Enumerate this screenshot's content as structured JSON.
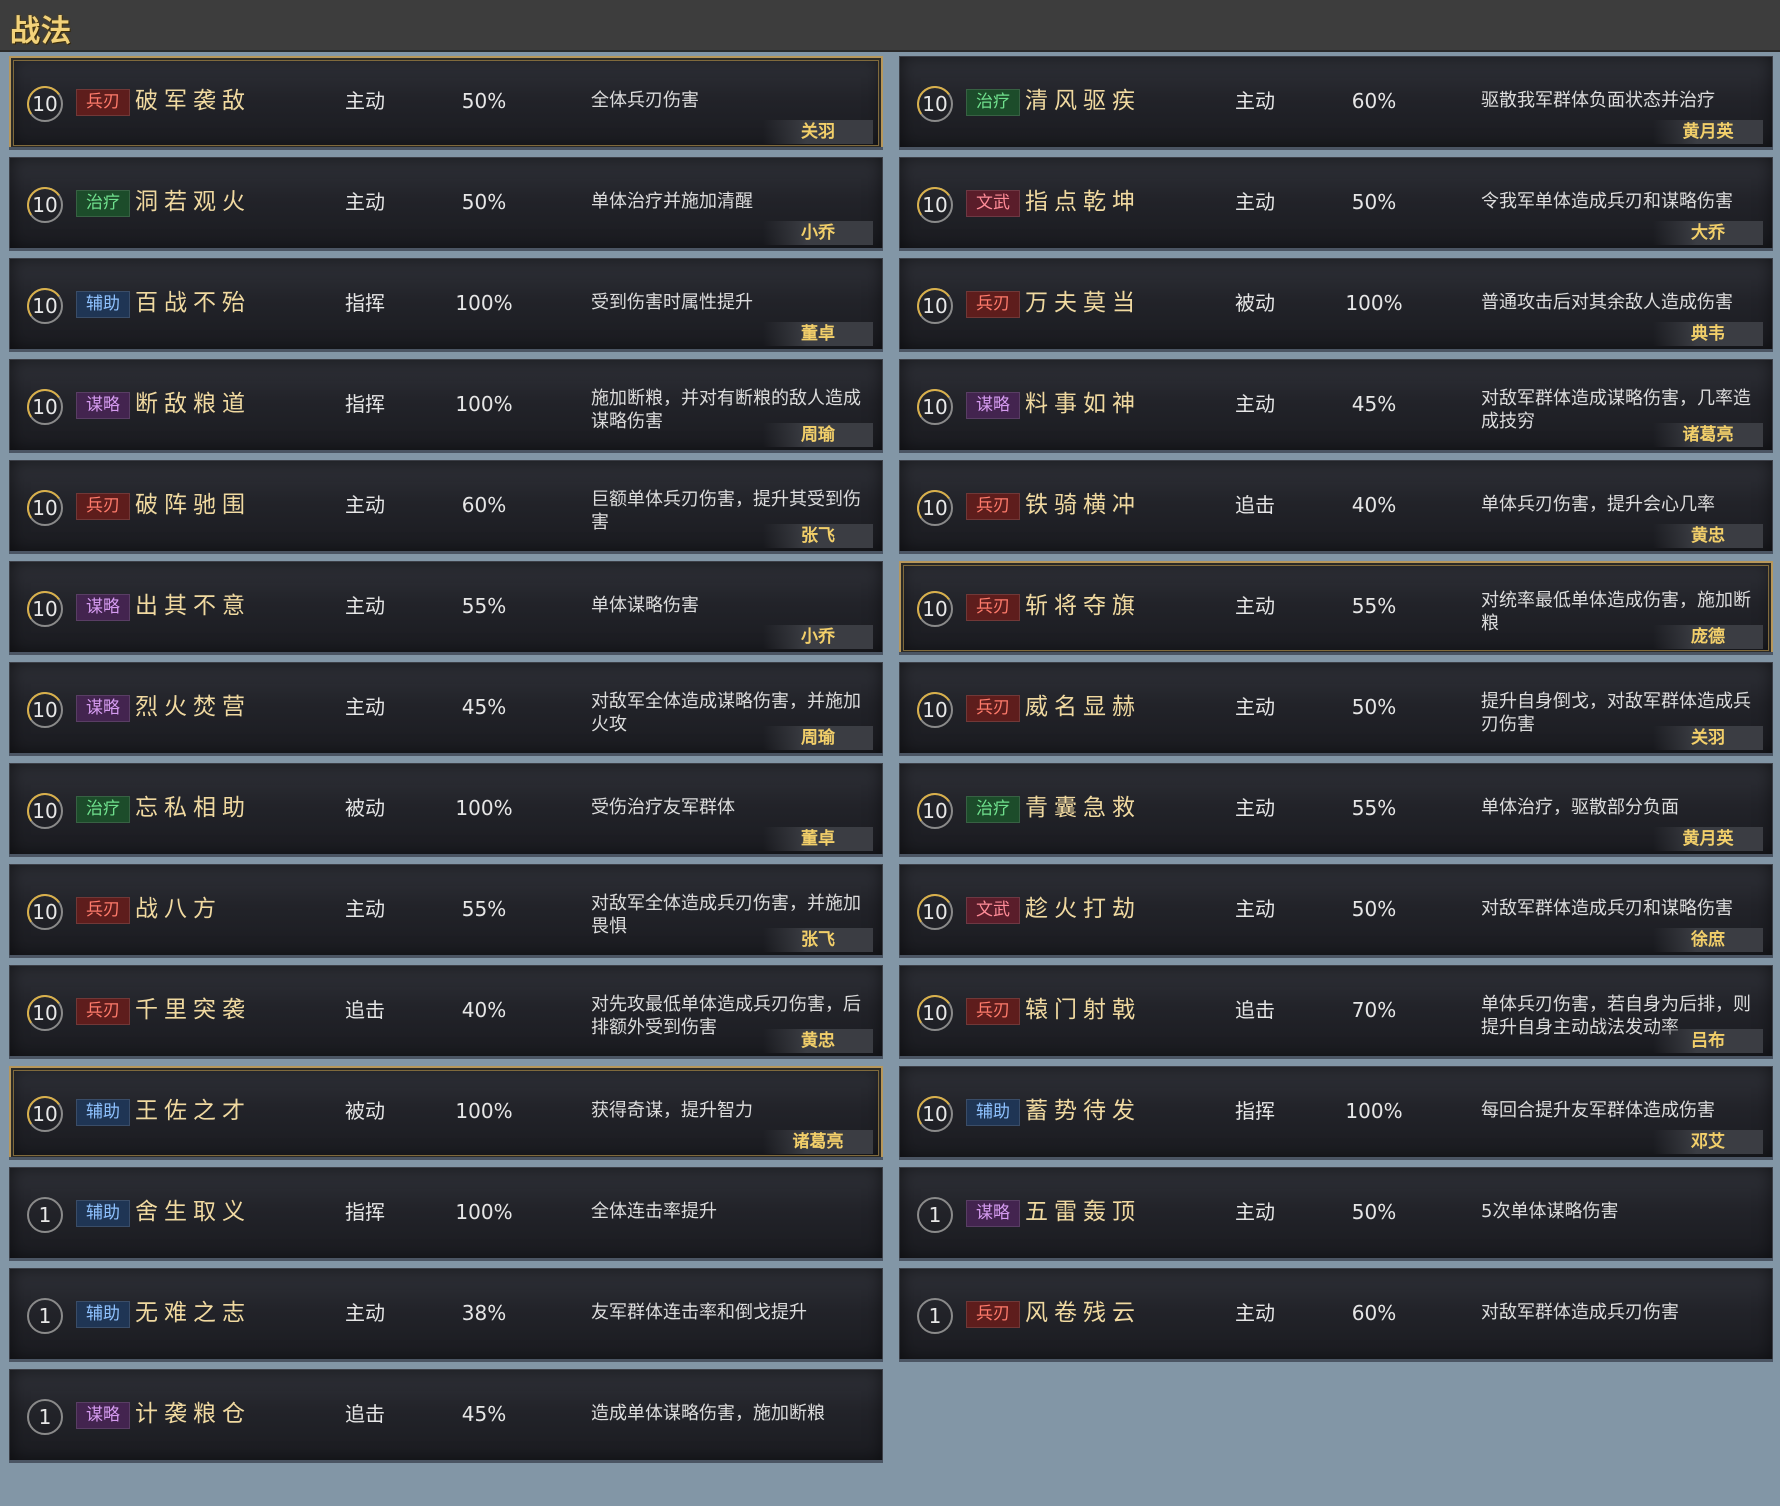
{
  "header": {
    "title": "战法"
  },
  "left": [
    {
      "level": "10",
      "tag": "兵刃",
      "tagClass": "t-bing",
      "name": "破军袭敌",
      "type": "主动",
      "rate": "50%",
      "desc": "全体兵刃伤害",
      "hero": "关羽",
      "gold": true
    },
    {
      "level": "10",
      "tag": "治疗",
      "tagClass": "t-zhi",
      "name": "洞若观火",
      "type": "主动",
      "rate": "50%",
      "desc": "单体治疗并施加清醒",
      "hero": "小乔",
      "gold": false
    },
    {
      "level": "10",
      "tag": "辅助",
      "tagClass": "t-fu",
      "name": "百战不殆",
      "type": "指挥",
      "rate": "100%",
      "desc": "受到伤害时属性提升",
      "hero": "董卓",
      "gold": false
    },
    {
      "level": "10",
      "tag": "谋略",
      "tagClass": "t-mou",
      "name": "断敌粮道",
      "type": "指挥",
      "rate": "100%",
      "desc": "施加断粮，并对有断粮的敌人造成谋略伤害",
      "hero": "周瑜",
      "gold": false
    },
    {
      "level": "10",
      "tag": "兵刃",
      "tagClass": "t-bing",
      "name": "破阵驰围",
      "type": "主动",
      "rate": "60%",
      "desc": "巨额单体兵刃伤害，提升其受到伤害",
      "hero": "张飞",
      "gold": false
    },
    {
      "level": "10",
      "tag": "谋略",
      "tagClass": "t-mou",
      "name": "出其不意",
      "type": "主动",
      "rate": "55%",
      "desc": "单体谋略伤害",
      "hero": "小乔",
      "gold": false
    },
    {
      "level": "10",
      "tag": "谋略",
      "tagClass": "t-mou",
      "name": "烈火焚营",
      "type": "主动",
      "rate": "45%",
      "desc": "对敌军全体造成谋略伤害，并施加火攻",
      "hero": "周瑜",
      "gold": false
    },
    {
      "level": "10",
      "tag": "治疗",
      "tagClass": "t-zhi",
      "name": "忘私相助",
      "type": "被动",
      "rate": "100%",
      "desc": "受伤治疗友军群体",
      "hero": "董卓",
      "gold": false
    },
    {
      "level": "10",
      "tag": "兵刃",
      "tagClass": "t-bing",
      "name": "战八方",
      "type": "主动",
      "rate": "55%",
      "desc": "对敌军全体造成兵刃伤害，并施加畏惧",
      "hero": "张飞",
      "gold": false
    },
    {
      "level": "10",
      "tag": "兵刃",
      "tagClass": "t-bing",
      "name": "千里突袭",
      "type": "追击",
      "rate": "40%",
      "desc": "对先攻最低单体造成兵刃伤害，后排额外受到伤害",
      "hero": "黄忠",
      "gold": false
    },
    {
      "level": "10",
      "tag": "辅助",
      "tagClass": "t-fu",
      "name": "王佐之才",
      "type": "被动",
      "rate": "100%",
      "desc": "获得奇谋，提升智力",
      "hero": "诸葛亮",
      "gold": true
    },
    {
      "level": "1",
      "tag": "辅助",
      "tagClass": "t-fu",
      "name": "舍生取义",
      "type": "指挥",
      "rate": "100%",
      "desc": "全体连击率提升",
      "hero": "",
      "gold": false
    },
    {
      "level": "1",
      "tag": "辅助",
      "tagClass": "t-fu",
      "name": "无难之志",
      "type": "主动",
      "rate": "38%",
      "desc": "友军群体连击率和倒戈提升",
      "hero": "",
      "gold": false
    },
    {
      "level": "1",
      "tag": "谋略",
      "tagClass": "t-mou",
      "name": "计袭粮仓",
      "type": "追击",
      "rate": "45%",
      "desc": "造成单体谋略伤害，施加断粮",
      "hero": "",
      "gold": false
    }
  ],
  "right": [
    {
      "level": "10",
      "tag": "治疗",
      "tagClass": "t-zhi",
      "name": "清风驱疾",
      "type": "主动",
      "rate": "60%",
      "desc": "驱散我军群体负面状态并治疗",
      "hero": "黄月英",
      "gold": false
    },
    {
      "level": "10",
      "tag": "文武",
      "tagClass": "t-wen",
      "name": "指点乾坤",
      "type": "主动",
      "rate": "50%",
      "desc": "令我军单体造成兵刃和谋略伤害",
      "hero": "大乔",
      "gold": false
    },
    {
      "level": "10",
      "tag": "兵刃",
      "tagClass": "t-bing",
      "name": "万夫莫当",
      "type": "被动",
      "rate": "100%",
      "desc": "普通攻击后对其余敌人造成伤害",
      "hero": "典韦",
      "gold": false
    },
    {
      "level": "10",
      "tag": "谋略",
      "tagClass": "t-mou",
      "name": "料事如神",
      "type": "主动",
      "rate": "45%",
      "desc": "对敌军群体造成谋略伤害，几率造成技穷",
      "hero": "诸葛亮",
      "gold": false
    },
    {
      "level": "10",
      "tag": "兵刃",
      "tagClass": "t-bing",
      "name": "铁骑横冲",
      "type": "追击",
      "rate": "40%",
      "desc": "单体兵刃伤害，提升会心几率",
      "hero": "黄忠",
      "gold": false
    },
    {
      "level": "10",
      "tag": "兵刃",
      "tagClass": "t-bing",
      "name": "斩将夺旗",
      "type": "主动",
      "rate": "55%",
      "desc": "对统率最低单体造成伤害，施加断粮",
      "hero": "庞德",
      "gold": true
    },
    {
      "level": "10",
      "tag": "兵刃",
      "tagClass": "t-bing",
      "name": "威名显赫",
      "type": "主动",
      "rate": "50%",
      "desc": "提升自身倒戈，对敌军群体造成兵刃伤害",
      "hero": "关羽",
      "gold": false
    },
    {
      "level": "10",
      "tag": "治疗",
      "tagClass": "t-zhi",
      "name": "青囊急救",
      "type": "主动",
      "rate": "55%",
      "desc": "单体治疗，驱散部分负面",
      "hero": "黄月英",
      "gold": false
    },
    {
      "level": "10",
      "tag": "文武",
      "tagClass": "t-wen",
      "name": "趁火打劫",
      "type": "主动",
      "rate": "50%",
      "desc": "对敌军群体造成兵刃和谋略伤害",
      "hero": "徐庶",
      "gold": false
    },
    {
      "level": "10",
      "tag": "兵刃",
      "tagClass": "t-bing",
      "name": "辕门射戟",
      "type": "追击",
      "rate": "70%",
      "desc": "单体兵刃伤害，若自身为后排，则提升自身主动战法发动率",
      "hero": "吕布",
      "gold": false
    },
    {
      "level": "10",
      "tag": "辅助",
      "tagClass": "t-fu",
      "name": "蓄势待发",
      "type": "指挥",
      "rate": "100%",
      "desc": "每回合提升友军群体造成伤害",
      "hero": "邓艾",
      "gold": false
    },
    {
      "level": "1",
      "tag": "谋略",
      "tagClass": "t-mou",
      "name": "五雷轰顶",
      "type": "主动",
      "rate": "50%",
      "desc": "5次单体谋略伤害",
      "hero": "",
      "gold": false
    },
    {
      "level": "1",
      "tag": "兵刃",
      "tagClass": "t-bing",
      "name": "风卷残云",
      "type": "主动",
      "rate": "60%",
      "desc": "对敌军群体造成兵刃伤害",
      "hero": "",
      "gold": false
    }
  ]
}
